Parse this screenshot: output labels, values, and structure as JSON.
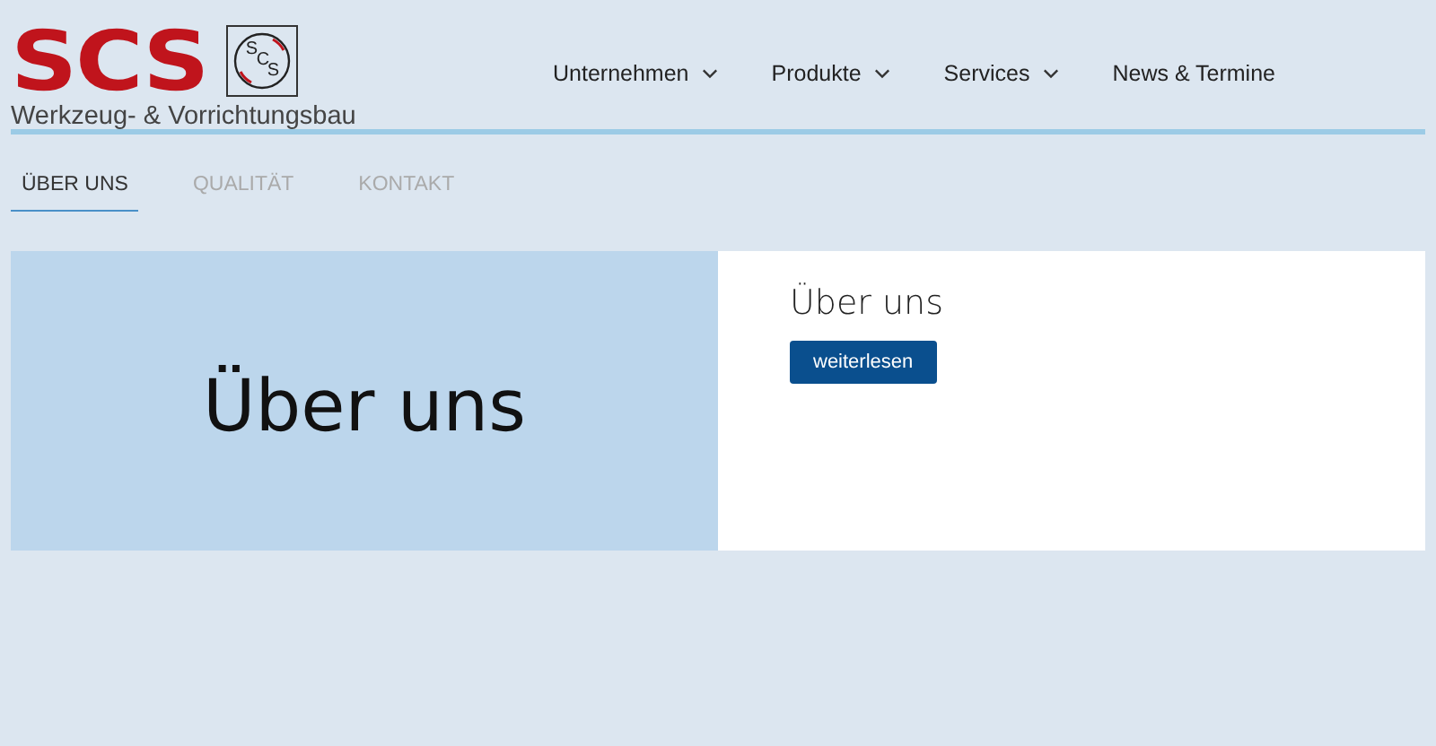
{
  "logo": {
    "wordmark": "SCS",
    "emblem_letters": [
      "S",
      "C",
      "S"
    ],
    "tagline": "Werkzeug- & Vorrichtungsbau"
  },
  "nav": [
    {
      "label": "Unternehmen",
      "dropdown": true
    },
    {
      "label": "Produkte",
      "dropdown": true
    },
    {
      "label": "Services",
      "dropdown": true
    },
    {
      "label": "News & Termine",
      "dropdown": false
    }
  ],
  "tabs": [
    {
      "label": "ÜBER UNS",
      "selected": true
    },
    {
      "label": "QUALITÄT",
      "selected": false
    },
    {
      "label": "KONTAKT",
      "selected": false
    }
  ],
  "panel": {
    "banner_text": "Über uns",
    "title": "Über uns",
    "button": "weiterlesen"
  }
}
